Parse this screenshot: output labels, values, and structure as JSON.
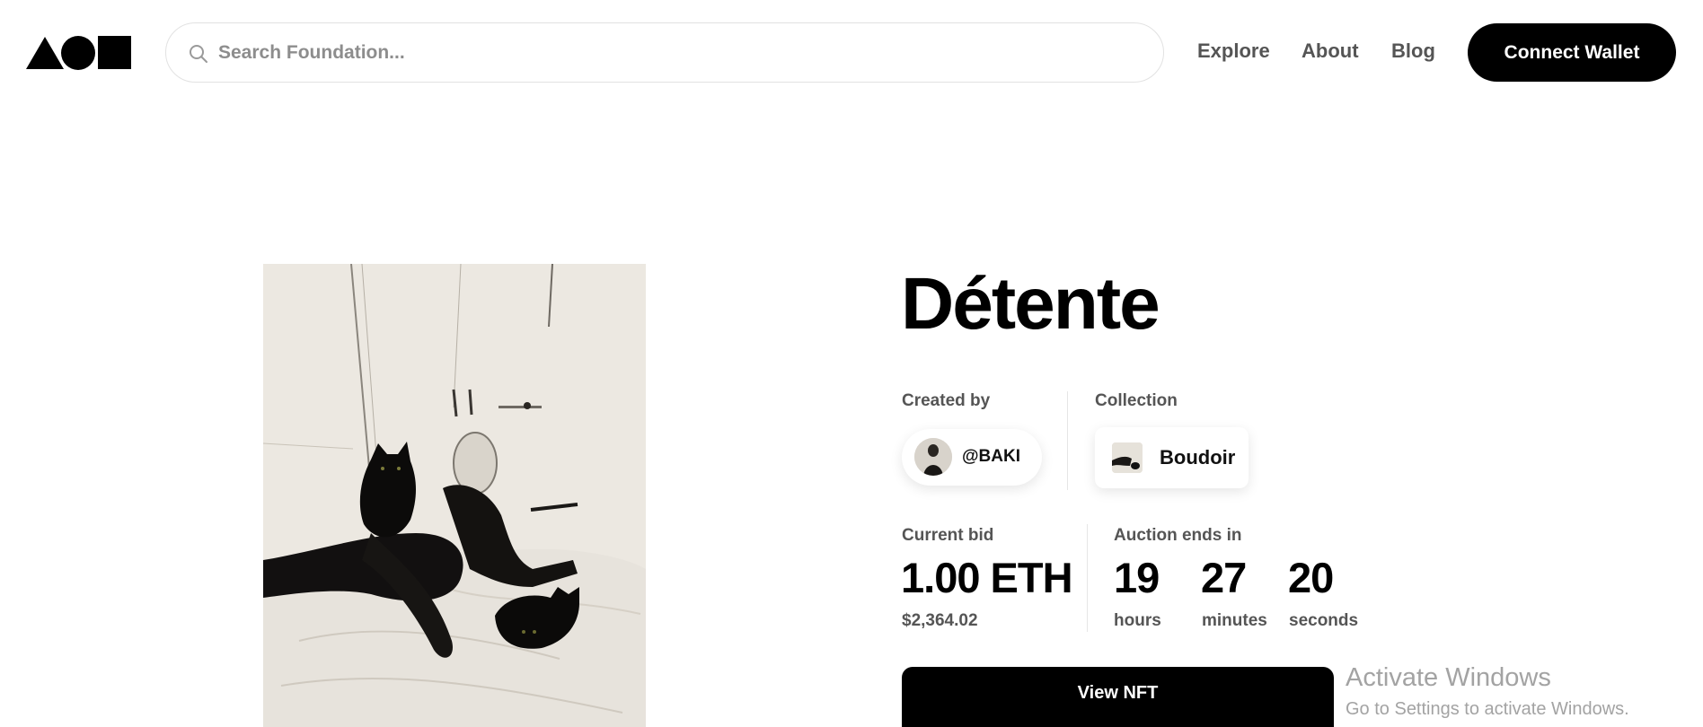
{
  "header": {
    "logo_icon": "foundation-shapes-logo",
    "search": {
      "placeholder": "Search Foundation...",
      "value": ""
    },
    "nav": [
      {
        "label": "Explore"
      },
      {
        "label": "About"
      },
      {
        "label": "Blog"
      }
    ],
    "connect_label": "Connect Wallet"
  },
  "artwork": {
    "icon": "artwork-image"
  },
  "nft": {
    "title": "Détente",
    "created_by_label": "Created by",
    "creator": "@BAKI",
    "collection_label": "Collection",
    "collection": "Boudoir",
    "current_bid_label": "Current bid",
    "current_bid": "1.00 ETH",
    "current_bid_usd": "$2,364.02",
    "auction_label": "Auction ends in",
    "countdown": {
      "hours": "19",
      "hours_label": "hours",
      "minutes": "27",
      "minutes_label": "minutes",
      "seconds": "20",
      "seconds_label": "seconds"
    },
    "view_label": "View NFT"
  },
  "watermark": {
    "title": "Activate Windows",
    "subtitle": "Go to Settings to activate Windows."
  },
  "colors": {
    "primary": "#000000",
    "muted_text": "#555555",
    "border": "#e2e2e2"
  }
}
